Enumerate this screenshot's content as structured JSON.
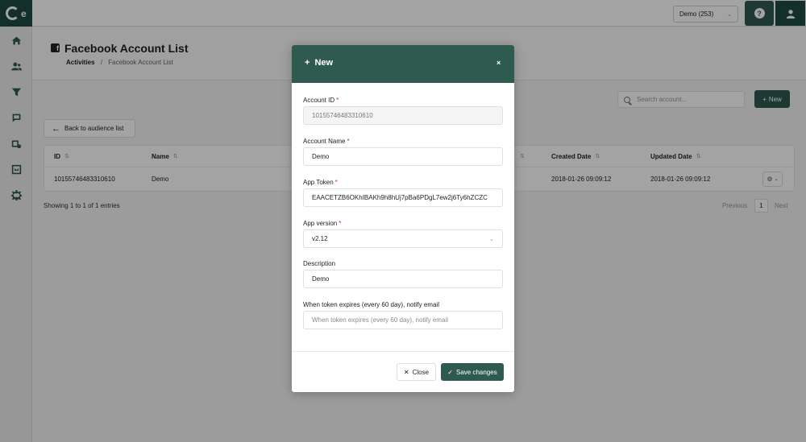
{
  "header": {
    "account_selector": "Demo (253)",
    "help_label": "?"
  },
  "logo": {
    "text": "e"
  },
  "page": {
    "title": "Facebook Account List",
    "breadcrumb": {
      "root": "Activities",
      "separator": "/",
      "current": "Facebook Account List"
    }
  },
  "toolbar": {
    "search_placeholder": "Search account...",
    "new_label": "New",
    "back_label": "Back to audience list"
  },
  "table": {
    "columns": {
      "id": "ID",
      "name": "Name",
      "created": "Created Date",
      "updated": "Updated Date"
    },
    "rows": [
      {
        "id": "10155746483310610",
        "name": "Demo",
        "created": "2018-01-26 09:09:12",
        "updated": "2018-01-26 09:09:12"
      }
    ],
    "entries_text": "Showing 1 to 1 of 1 entries",
    "pagination": {
      "previous": "Previous",
      "current": "1",
      "next": "Next"
    }
  },
  "modal": {
    "title": "New",
    "close_symbol": "×",
    "fields": {
      "account_id": {
        "label": "Account ID",
        "value": "10155746483310610"
      },
      "account_name": {
        "label": "Account Name",
        "value": "Demo"
      },
      "app_token": {
        "label": "App Token",
        "value": "EAACETZB6OKhIBAKh9h8hUj7pBa6PDgL7ew2j6Ty6hZCZC"
      },
      "app_version": {
        "label": "App version",
        "value": "v2.12"
      },
      "description": {
        "label": "Description",
        "value": "Demo"
      },
      "notify_email": {
        "label": "When token expires (every 60 day), notify email",
        "placeholder": "When token expires (every 60 day), notify email"
      }
    },
    "required_mark": "*",
    "buttons": {
      "close": "Close",
      "save": "Save changes"
    }
  },
  "colors": {
    "brand_dark": "#1f4a40",
    "brand": "#2f5a50",
    "required": "#c0392b"
  },
  "icons": [
    "home-icon",
    "users-icon",
    "filter-icon",
    "chat-icon",
    "database-icon",
    "frame-icon",
    "gear-icon",
    "user-icon",
    "facebook-icon",
    "search-icon",
    "arrow-left-icon",
    "check-icon",
    "close-icon",
    "plus-icon"
  ]
}
